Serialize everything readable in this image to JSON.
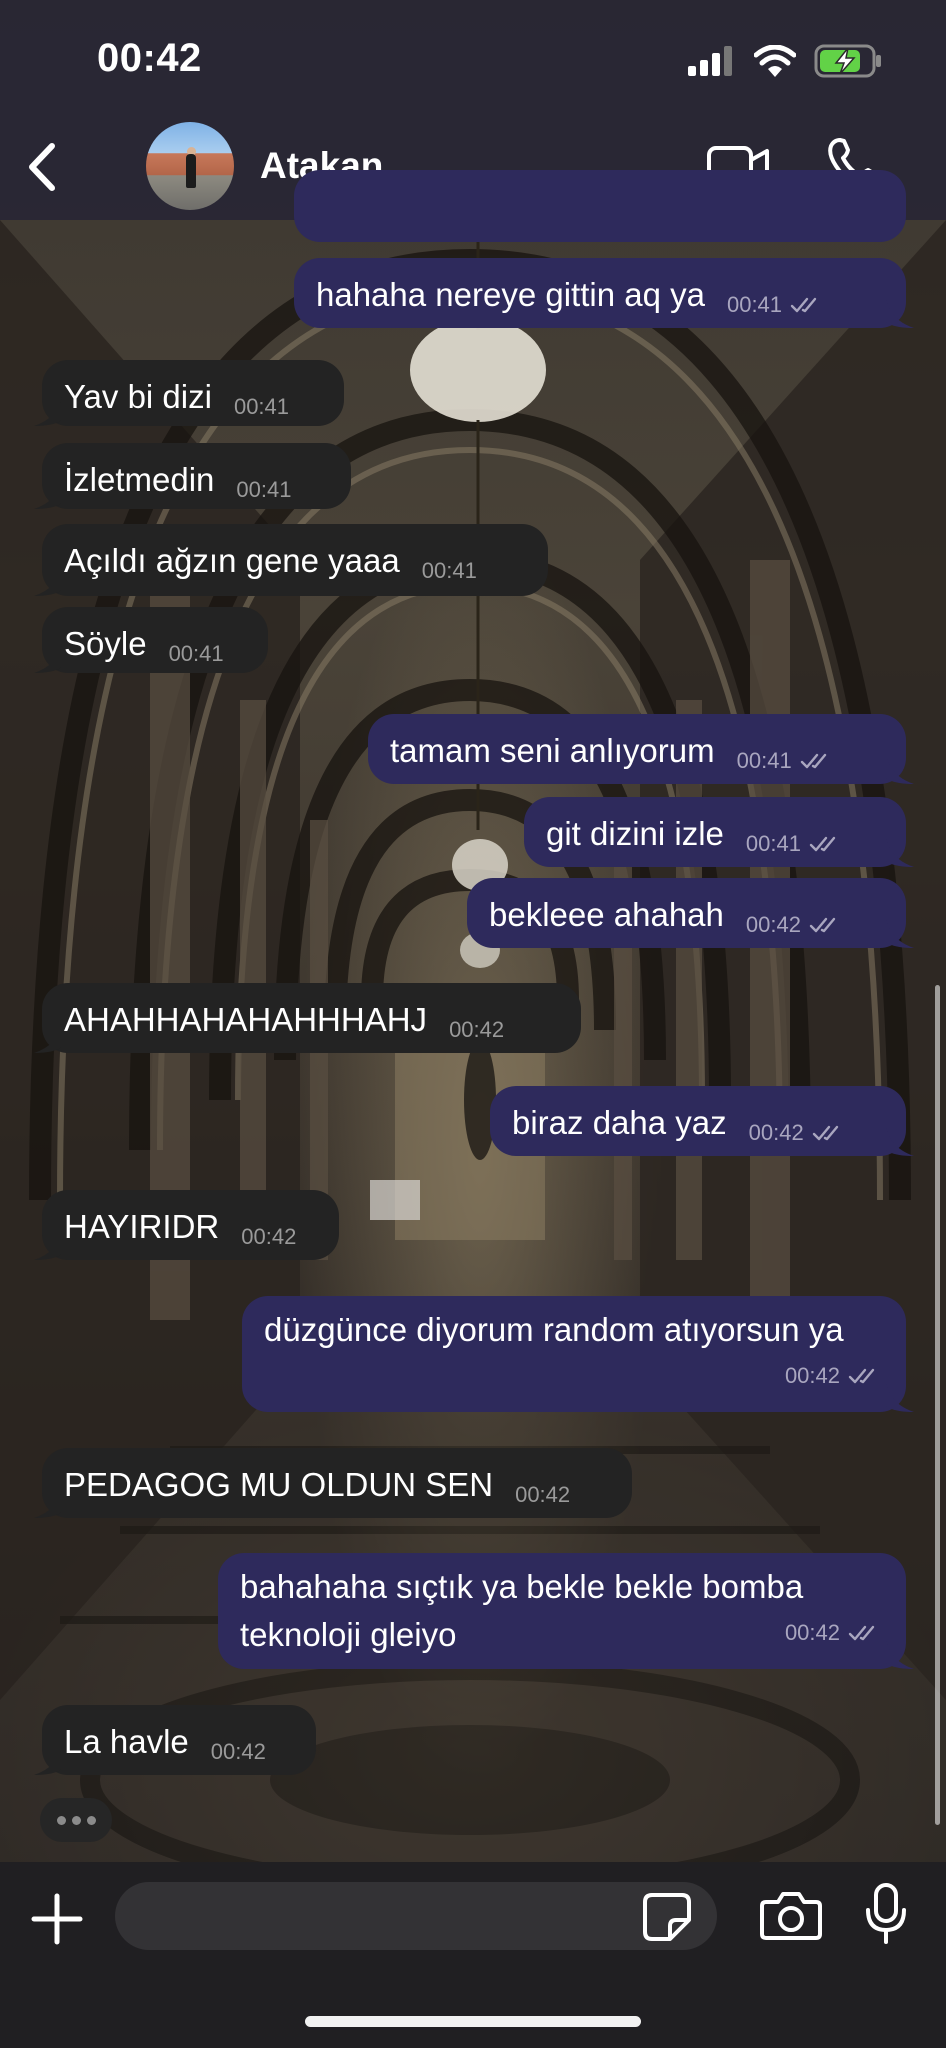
{
  "status_bar": {
    "time": "00:42",
    "battery_state": "charging"
  },
  "header": {
    "contact_name": "Atakan"
  },
  "theme": {
    "outgoing_bubble": "#2e2a5c",
    "incoming_bubble": "#232323",
    "read_ticks": "#a9a6bf"
  },
  "messages": [
    {
      "dir": "out",
      "text": "hahaha nereye gittin aq ya",
      "time": "00:41",
      "read": true
    },
    {
      "dir": "in",
      "text": "Yav bi dizi",
      "time": "00:41"
    },
    {
      "dir": "in",
      "text": "İzletmedin",
      "time": "00:41"
    },
    {
      "dir": "in",
      "text": "Açıldı ağzın gene yaaa",
      "time": "00:41"
    },
    {
      "dir": "in",
      "text": "Söyle",
      "time": "00:41"
    },
    {
      "dir": "out",
      "text": "tamam seni anlıyorum",
      "time": "00:41",
      "read": true
    },
    {
      "dir": "out",
      "text": "git dizini izle",
      "time": "00:41",
      "read": true
    },
    {
      "dir": "out",
      "text": "bekleee ahahah",
      "time": "00:42",
      "read": true
    },
    {
      "dir": "in",
      "text": "AHAHHAHAHAHHHAHJ",
      "time": "00:42"
    },
    {
      "dir": "out",
      "text": "biraz daha yaz",
      "time": "00:42",
      "read": true
    },
    {
      "dir": "in",
      "text": "HAYIRIDR",
      "time": "00:42"
    },
    {
      "dir": "out",
      "text": "düzgünce diyorum random atıyorsun ya",
      "time": "00:42",
      "read": true
    },
    {
      "dir": "in",
      "text": "PEDAGOG MU OLDUN SEN",
      "time": "00:42"
    },
    {
      "dir": "out",
      "text": "bahahaha sıçtık ya bekle bekle bomba teknoloji gleiyo",
      "time": "00:42",
      "read": true
    },
    {
      "dir": "in",
      "text": "La havle",
      "time": "00:42"
    }
  ],
  "composer": {
    "value": "",
    "placeholder": ""
  }
}
